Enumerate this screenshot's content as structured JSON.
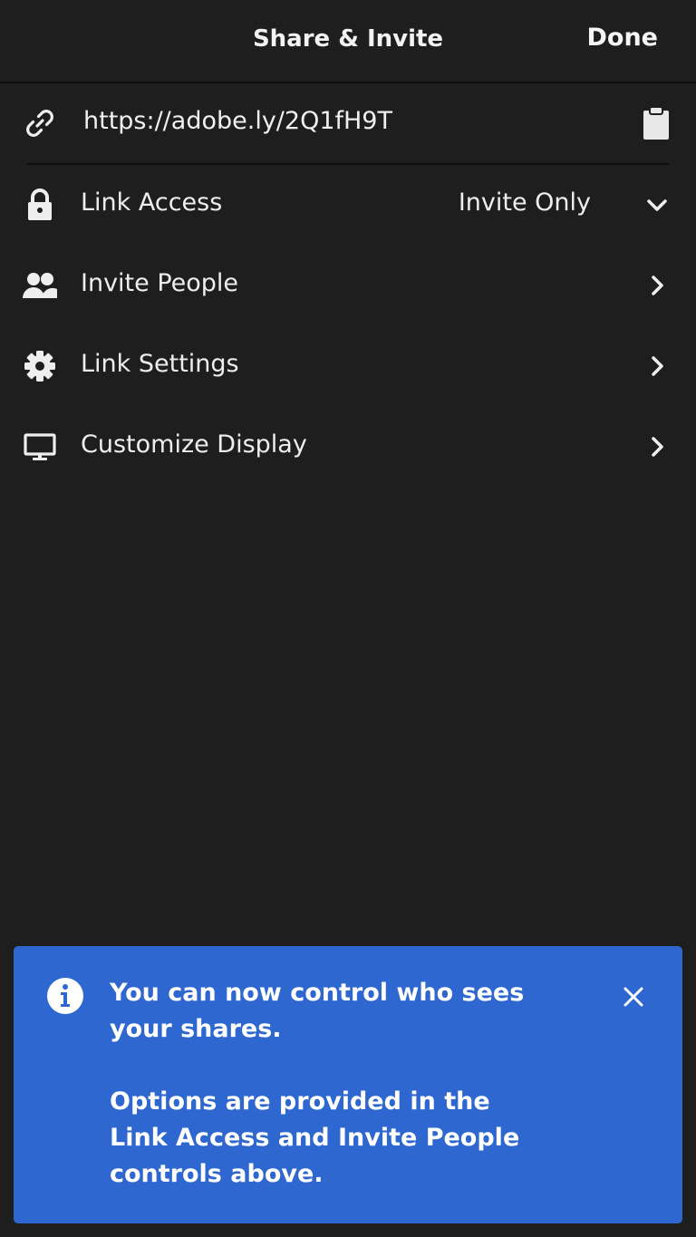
{
  "header": {
    "title": "Share & Invite",
    "done_label": "Done"
  },
  "link": {
    "url": "https://adobe.ly/2Q1fH9T",
    "icon": "link-icon",
    "copy_icon": "clipboard-icon"
  },
  "menu": {
    "items": [
      {
        "label": "Link Access",
        "value": "Invite Only",
        "icon": "lock-icon",
        "indicator": "chevron-down-icon"
      },
      {
        "label": "Invite People",
        "icon": "people-icon",
        "indicator": "chevron-right-icon"
      },
      {
        "label": "Link Settings",
        "icon": "gear-icon",
        "indicator": "chevron-right-icon"
      },
      {
        "label": "Customize Display",
        "icon": "monitor-icon",
        "indicator": "chevron-right-icon"
      }
    ]
  },
  "banner": {
    "message_1": "You can now control who sees your shares.",
    "message_2": "Options are provided in the Link Access and Invite People controls above.",
    "icon": "info-icon",
    "close_icon": "close-icon",
    "color": "#2d67cf"
  },
  "colors": {
    "background": "#1e1e1e",
    "text": "#f2f2f2",
    "divider": "#0f0f0f"
  }
}
